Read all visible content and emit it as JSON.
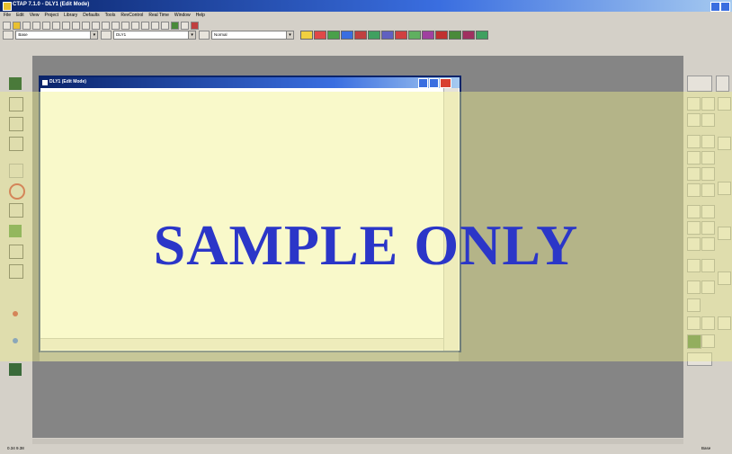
{
  "app": {
    "title": "CTAP 7.1.0 - DLY1 (Edit Mode)"
  },
  "menu": [
    "File",
    "Edit",
    "View",
    "Project",
    "Library",
    "Defaults",
    "Tools",
    "RevControl",
    "Real Time",
    "Window",
    "Help"
  ],
  "toolbar2": {
    "combo1": "Base",
    "combo2": "DLY1",
    "combo3": "Normal"
  },
  "doc_window": {
    "title": "DLY1 (Edit Mode)"
  },
  "status": {
    "left": "0.34   9.38",
    "right": "Base"
  },
  "watermark": "SAMPLE ONLY",
  "colors": {
    "titlebar": "#0a246a",
    "workspace": "#858585",
    "watermark": "#2b36c8",
    "overlay": "#eeee8c"
  }
}
